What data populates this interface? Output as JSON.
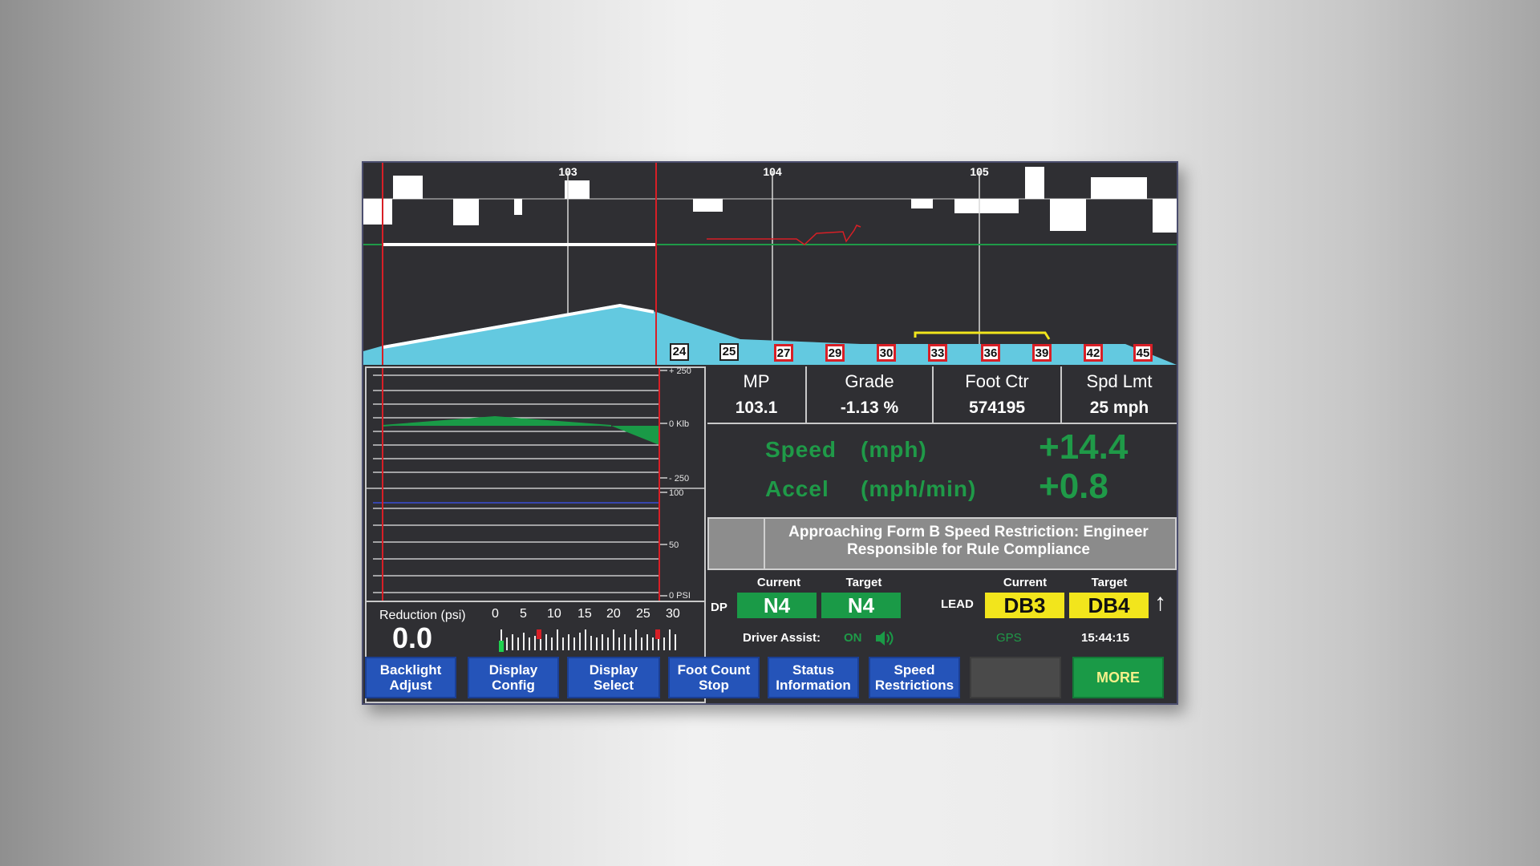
{
  "profile": {
    "milepost_labels": [
      "103",
      "104",
      "105"
    ],
    "signs": [
      {
        "label": "24",
        "style": "black"
      },
      {
        "label": "25",
        "style": "black"
      },
      {
        "label": "27",
        "style": "red"
      },
      {
        "label": "29",
        "style": "red"
      },
      {
        "label": "30",
        "style": "red"
      },
      {
        "label": "33",
        "style": "red"
      },
      {
        "label": "36",
        "style": "red"
      },
      {
        "label": "39",
        "style": "red"
      },
      {
        "label": "42",
        "style": "red"
      },
      {
        "label": "45",
        "style": "red"
      }
    ]
  },
  "graphs": {
    "force_axis": {
      "top": "+ 250",
      "mid": "0 Klb",
      "bottom": "- 250"
    },
    "pressure_axis": {
      "top": "100",
      "mid": "50",
      "bottom": "0 PSI"
    },
    "reduction": {
      "label": "Reduction (psi)",
      "value": "0.0",
      "scale_labels": [
        "0",
        "5",
        "10",
        "15",
        "20",
        "25",
        "30"
      ]
    }
  },
  "info": {
    "mp": {
      "title": "MP",
      "value": "103.1"
    },
    "grade": {
      "title": "Grade",
      "value": "-1.13 %"
    },
    "foot_ctr": {
      "title": "Foot Ctr",
      "value": "574195"
    },
    "spd_lmt": {
      "title": "Spd Lmt",
      "value": "25 mph"
    }
  },
  "motion": {
    "speed_label": "Speed",
    "speed_unit": "(mph)",
    "speed_value": "+14.4",
    "accel_label": "Accel",
    "accel_unit": "(mph/min)",
    "accel_value": "+0.8"
  },
  "message": {
    "text": "Approaching Form B Speed Restriction: Engineer Responsible for Rule Compliance"
  },
  "status": {
    "dp_label": "DP",
    "lead_label": "LEAD",
    "current_label": "Current",
    "target_label": "Target",
    "dp_current": "N4",
    "dp_target": "N4",
    "lead_current": "DB3",
    "lead_target": "DB4",
    "driver_assist_label": "Driver Assist:",
    "driver_assist_value": "ON",
    "gps_label": "GPS",
    "time": "15:44:15"
  },
  "buttons": {
    "backlight_adjust": [
      "Backlight",
      "Adjust"
    ],
    "display_config": [
      "Display",
      "Config"
    ],
    "display_select": [
      "Display",
      "Select"
    ],
    "foot_count_stop": [
      "Foot Count",
      "Stop"
    ],
    "status_information": [
      "Status",
      "Information"
    ],
    "speed_restrictions": [
      "Speed",
      "Restrictions"
    ],
    "more": "MORE"
  },
  "colors": {
    "screen_bg": "#2f2f33",
    "terrain": "#63c9e0",
    "status_green": "#1a9a47",
    "lead_yellow": "#f2e51c",
    "button_blue": "#2554b9",
    "limit_red": "#d81f26"
  }
}
